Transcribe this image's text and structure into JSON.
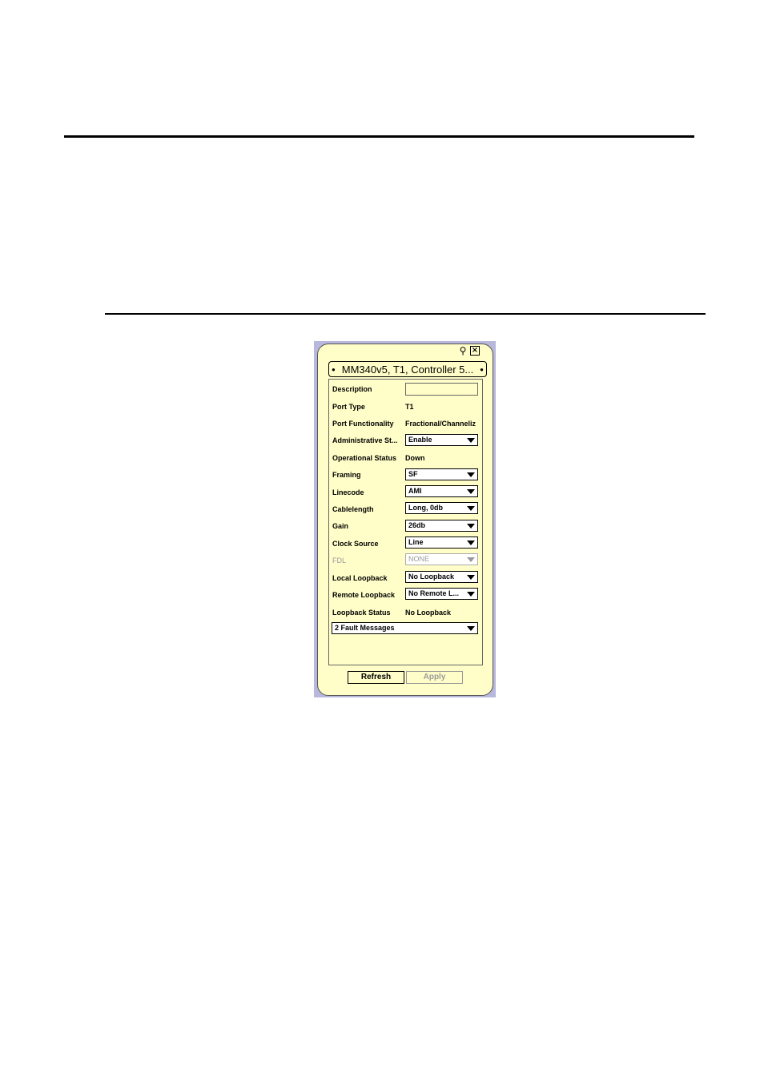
{
  "panel": {
    "tab_title": "MM340v5, T1, Controller 5...",
    "fields": [
      {
        "key": "description",
        "label": "Description",
        "kind": "input",
        "value": ""
      },
      {
        "key": "port-type",
        "label": "Port Type",
        "kind": "text",
        "value": "T1"
      },
      {
        "key": "port-functionality",
        "label": "Port Functionality",
        "kind": "text",
        "value": "Fractional/Channeliz"
      },
      {
        "key": "administrative-status",
        "label": "Administrative St...",
        "kind": "select",
        "value": "Enable"
      },
      {
        "key": "operational-status",
        "label": "Operational Status",
        "kind": "text",
        "value": "Down"
      },
      {
        "key": "framing",
        "label": "Framing",
        "kind": "select",
        "value": "SF"
      },
      {
        "key": "linecode",
        "label": "Linecode",
        "kind": "select",
        "value": "AMI"
      },
      {
        "key": "cablelength",
        "label": "Cablelength",
        "kind": "select",
        "value": "Long, 0db"
      },
      {
        "key": "gain",
        "label": "Gain",
        "kind": "select",
        "value": "26db"
      },
      {
        "key": "clock-source",
        "label": "Clock Source",
        "kind": "select",
        "value": "Line"
      },
      {
        "key": "fdl",
        "label": "FDL",
        "kind": "select",
        "value": "NONE",
        "disabled": true
      },
      {
        "key": "local-loopback",
        "label": "Local Loopback",
        "kind": "select",
        "value": "No Loopback"
      },
      {
        "key": "remote-loopback",
        "label": "Remote Loopback",
        "kind": "select",
        "value": "No Remote L..."
      },
      {
        "key": "loopback-status",
        "label": "Loopback Status",
        "kind": "text",
        "value": "No Loopback"
      }
    ],
    "fault_messages": "2 Fault Messages",
    "buttons": {
      "refresh": "Refresh",
      "apply": "Apply"
    }
  }
}
